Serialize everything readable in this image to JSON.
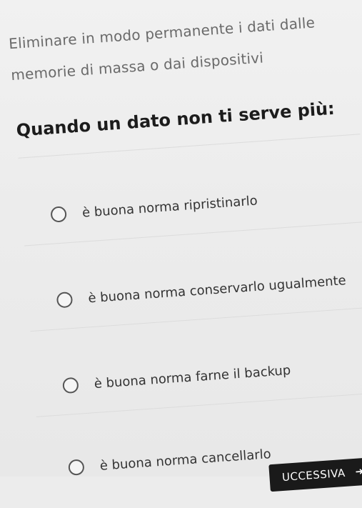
{
  "quiz": {
    "topic_line1": "Eliminare in modo permanente i dati dalle",
    "topic_line2": "memorie di massa o dai dispositivi",
    "question": "Quando un dato non ti serve più:",
    "options": [
      {
        "label": "è buona norma ripristinarlo"
      },
      {
        "label": "è buona norma conservarlo ugualmente"
      },
      {
        "label": "è buona norma farne il backup"
      },
      {
        "label": "è buona norma cancellarlo"
      }
    ],
    "submit_label": "UCCESSIVA",
    "submit_icon": "arrow-right-icon"
  }
}
